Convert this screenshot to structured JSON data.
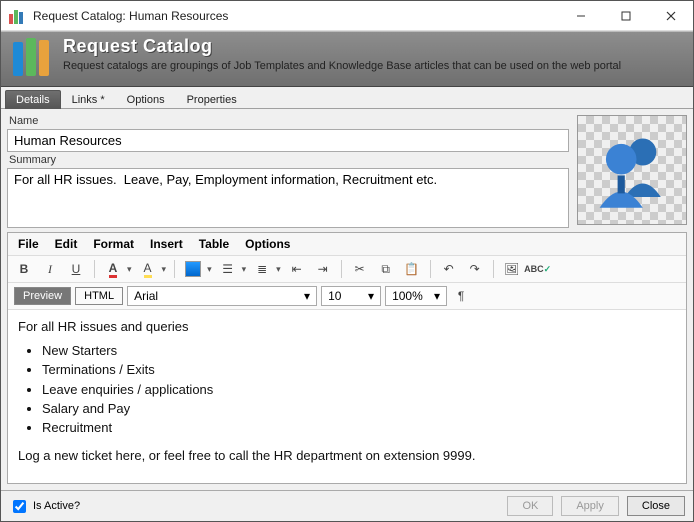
{
  "window": {
    "title": "Request Catalog: Human Resources"
  },
  "header": {
    "title": "Request Catalog",
    "description": "Request catalogs are groupings of Job Templates and Knowledge Base articles that can be used on the web portal"
  },
  "tabs": [
    {
      "label": "Details",
      "active": true
    },
    {
      "label": "Links *",
      "active": false
    },
    {
      "label": "Options",
      "active": false
    },
    {
      "label": "Properties",
      "active": false
    }
  ],
  "fields": {
    "name_label": "Name",
    "name_value": "Human Resources",
    "summary_label": "Summary",
    "summary_value": "For all HR issues.  Leave, Pay, Employment information, Recruitment etc."
  },
  "editor": {
    "menus": [
      "File",
      "Edit",
      "Format",
      "Insert",
      "Table",
      "Options"
    ],
    "view_tabs": {
      "preview": "Preview",
      "html": "HTML"
    },
    "font": "Arial",
    "font_size": "10",
    "zoom": "100%",
    "body_intro": "For all HR issues and queries",
    "body_items": [
      "New Starters",
      "Terminations / Exits",
      "Leave enquiries / applications",
      "Salary and Pay",
      "Recruitment"
    ],
    "body_outro": "Log a new ticket here, or feel free to call the HR department on extension 9999."
  },
  "footer": {
    "is_active_label": "Is Active?",
    "is_active_checked": true,
    "ok": "OK",
    "apply": "Apply",
    "close": "Close"
  }
}
